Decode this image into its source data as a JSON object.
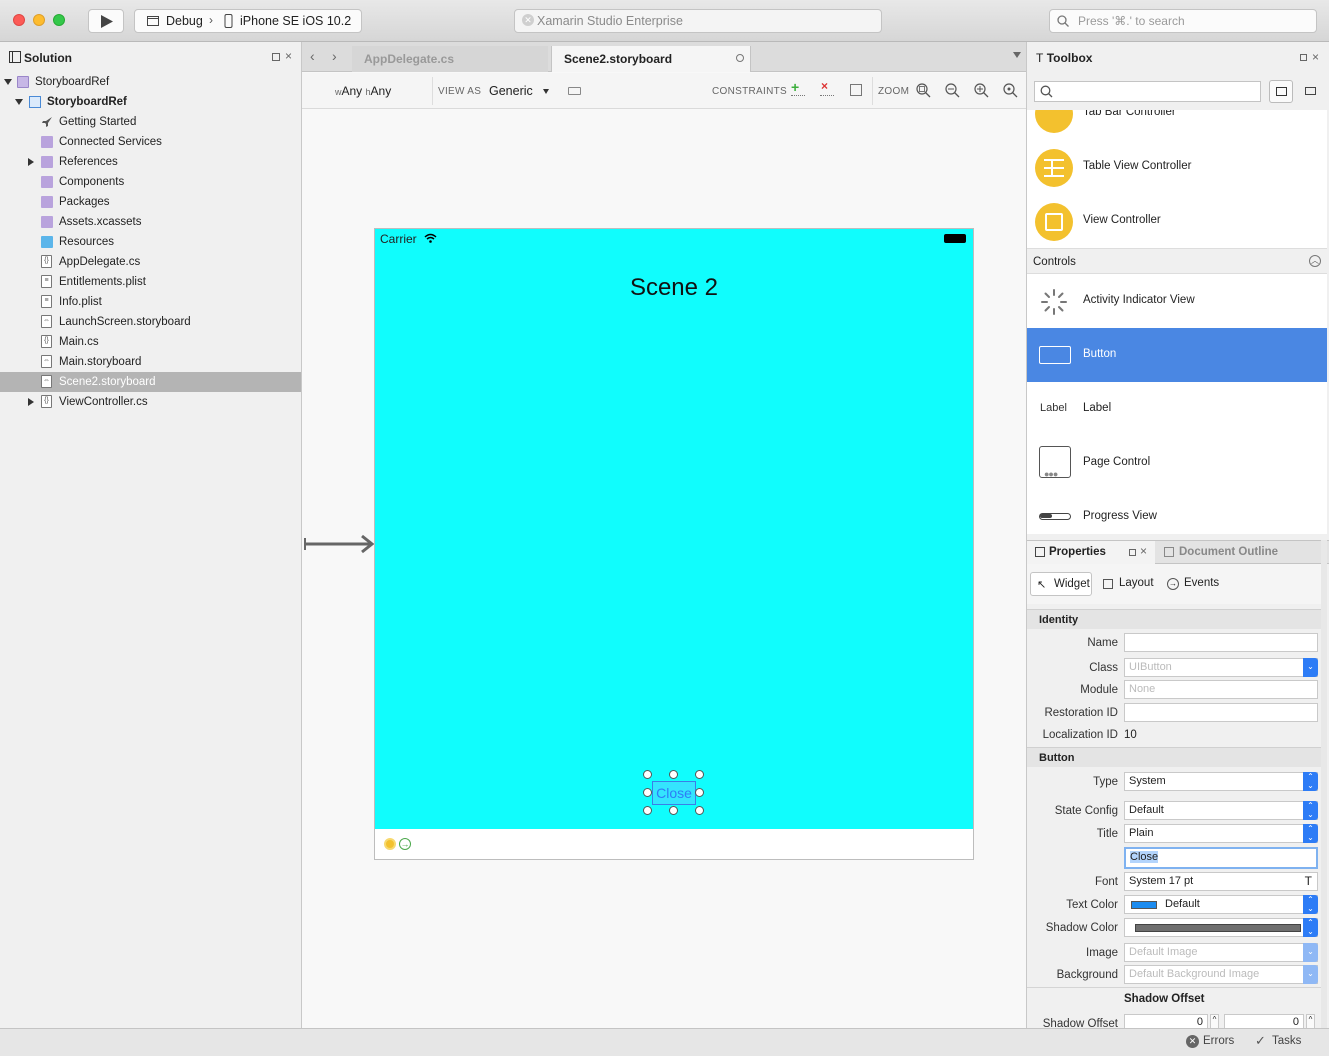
{
  "titlebar": {
    "config": "Debug",
    "device": "iPhone SE iOS 10.2",
    "app_title": "Xamarin Studio Enterprise",
    "search_placeholder": "Press '⌘.' to search"
  },
  "solution": {
    "title": "Solution",
    "items": [
      {
        "label": "StoryboardRef",
        "icon": "solution-icon"
      },
      {
        "label": "StoryboardRef",
        "icon": "project-icon"
      },
      {
        "label": "Getting Started",
        "icon": "rocket-icon"
      },
      {
        "label": "Connected Services",
        "icon": "folder-icon"
      },
      {
        "label": "References",
        "icon": "folder-icon"
      },
      {
        "label": "Components",
        "icon": "folder-icon"
      },
      {
        "label": "Packages",
        "icon": "folder-icon"
      },
      {
        "label": "Assets.xcassets",
        "icon": "folder-icon"
      },
      {
        "label": "Resources",
        "icon": "folder-icon"
      },
      {
        "label": "AppDelegate.cs",
        "icon": "code-file-icon"
      },
      {
        "label": "Entitlements.plist",
        "icon": "plist-file-icon"
      },
      {
        "label": "Info.plist",
        "icon": "plist-file-icon"
      },
      {
        "label": "LaunchScreen.storyboard",
        "icon": "storyboard-file-icon"
      },
      {
        "label": "Main.cs",
        "icon": "code-file-icon"
      },
      {
        "label": "Main.storyboard",
        "icon": "storyboard-file-icon"
      },
      {
        "label": "Scene2.storyboard",
        "icon": "storyboard-file-icon"
      },
      {
        "label": "ViewController.cs",
        "icon": "code-file-icon"
      }
    ]
  },
  "tabs": [
    "AppDelegate.cs",
    "Scene2.storyboard"
  ],
  "designer_toolbar": {
    "size_class_w": "Any",
    "size_class_h": "Any",
    "view_as_label": "VIEW AS",
    "view_as_value": "Generic",
    "constraints_label": "CONSTRAINTS",
    "zoom_label": "ZOOM"
  },
  "scene": {
    "carrier": "Carrier",
    "title": "Scene 2",
    "button_title": "Close",
    "background": "#10fdfd"
  },
  "toolbox": {
    "title": "Toolbox",
    "items_top": [
      "Tab Bar Controller",
      "Table View Controller",
      "View Controller"
    ],
    "section": "Controls",
    "items_controls": [
      "Activity Indicator View",
      "Button",
      "Label",
      "Page Control",
      "Progress View"
    ],
    "label_icon_text": "Label"
  },
  "properties": {
    "tab_properties": "Properties",
    "tab_outline": "Document Outline",
    "subtabs": [
      "Widget",
      "Layout",
      "Events"
    ],
    "identity_section": "Identity",
    "identity": {
      "name_label": "Name",
      "name_value": "",
      "class_label": "Class",
      "class_value": "UIButton",
      "module_label": "Module",
      "module_value": "None",
      "restoration_label": "Restoration ID",
      "restoration_value": "",
      "localization_label": "Localization ID",
      "localization_value": "10"
    },
    "button_section": "Button",
    "button": {
      "type_label": "Type",
      "type_value": "System",
      "state_label": "State Config",
      "state_value": "Default",
      "title_label": "Title",
      "title_value": "Plain",
      "title_text": "Close",
      "font_label": "Font",
      "font_value": "System 17 pt",
      "textcolor_label": "Text Color",
      "textcolor_value": "Default",
      "shadowcolor_label": "Shadow Color",
      "image_label": "Image",
      "image_value": "Default Image",
      "background_label": "Background",
      "background_value": "Default Background Image"
    },
    "shadow_offset_title": "Shadow Offset",
    "shadow_offset_label": "Shadow Offset",
    "shadow_offset_x": "0",
    "shadow_offset_y": "0"
  },
  "statusbar": {
    "errors": "Errors",
    "tasks": "Tasks"
  },
  "colors": {
    "accent": "#4a87e3",
    "highlight_row": "#b4b4b4",
    "toolbox_icon": "#f3c12e"
  }
}
